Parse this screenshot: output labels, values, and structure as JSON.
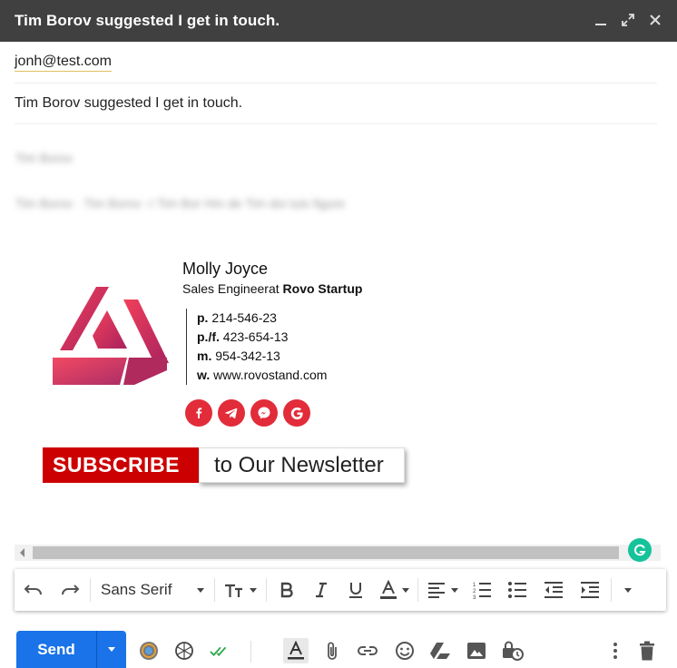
{
  "window": {
    "title": "Tim Borov suggested I get in touch."
  },
  "compose": {
    "to": "jonh@test.com",
    "subject": "Tim Borov suggested I get in touch.",
    "blurred_line_1": "Tim Borov",
    "blurred_line_2": "Tim Borov · Tim Borov   ·/·Tim Bor Hm de Tim doi tuis figure"
  },
  "signature": {
    "name": "Molly Joyce",
    "role": "Sales Engineerat",
    "company": "Rovo Startup",
    "contacts": [
      {
        "key": "p.",
        "value": "214-546-23"
      },
      {
        "key": "p./f.",
        "value": "423-654-13"
      },
      {
        "key": "m.",
        "value": "954-342-13"
      },
      {
        "key": "w.",
        "value": "www.rovostand.com"
      }
    ],
    "socials": [
      "facebook-icon",
      "telegram-icon",
      "messenger-icon",
      "google-icon"
    ],
    "subscribe_button": "SUBSCRIBE",
    "subscribe_text": "to Our Newsletter"
  },
  "toolbar": {
    "font": "Sans Serif"
  },
  "actions": {
    "send_label": "Send"
  },
  "colors": {
    "brand_red": "#e22c3a",
    "send_blue": "#1a73e8",
    "titlebar": "#404040",
    "grammarly": "#15c39a"
  }
}
